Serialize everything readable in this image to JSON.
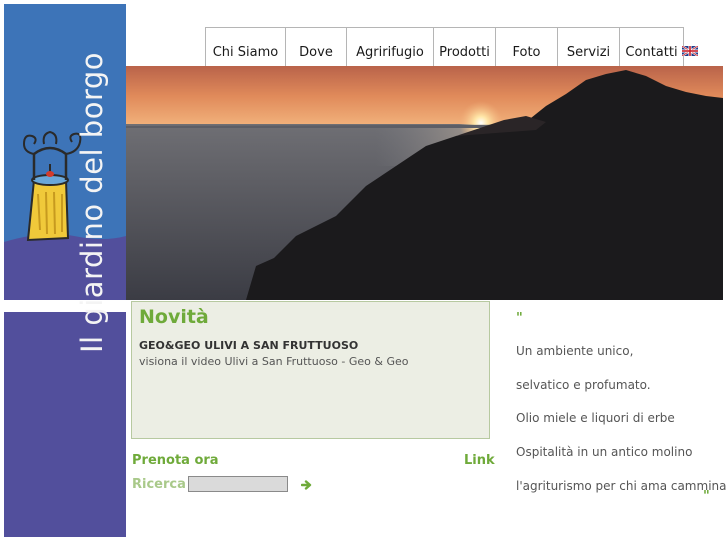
{
  "site": {
    "name": "Il giardino del borgo"
  },
  "nav": {
    "items": [
      {
        "label": "Chi Siamo"
      },
      {
        "label": "Dove"
      },
      {
        "label": "Agririfugio"
      },
      {
        "label": "Prodotti"
      },
      {
        "label": "Foto"
      },
      {
        "label": "Servizi"
      },
      {
        "label": "Contatti"
      }
    ],
    "language_icon": "uk-flag-icon"
  },
  "news": {
    "title": "Novità",
    "headline": "GEO&GEO ULIVI A SAN FRUTTUOSO",
    "link_text": "visiona il video Ulivi a San Fruttuoso - Geo & Geo"
  },
  "actions": {
    "prenota": "Prenota ora",
    "link": "Link",
    "search_label": "Ricerca",
    "search_value": "",
    "go_icon": "arrow-right-icon"
  },
  "taglines": {
    "quote_open": "\"",
    "quote_close": "\"",
    "lines": [
      "Un ambiente unico,",
      "selvatico e profumato.",
      "Olio miele e liquori di erbe",
      "Ospitalità in un antico molino",
      "l'agriturismo per chi ama camminare."
    ]
  },
  "colors": {
    "blue_panel": "#3d74b8",
    "purple_panel": "#524f9c",
    "accent_green": "#6faa3a",
    "news_background": "#eceee4"
  }
}
